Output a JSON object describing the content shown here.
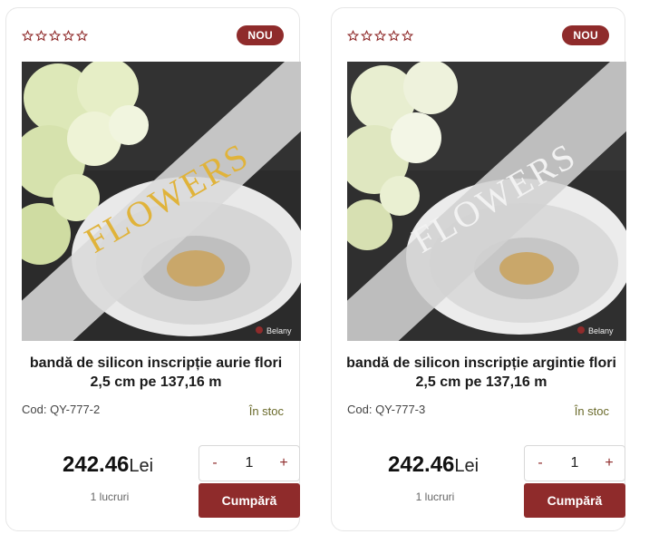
{
  "colors": {
    "accent": "#8f2b2b",
    "stock_text": "#6b6b2c",
    "star_outline": "#8f2b2b"
  },
  "products": [
    {
      "badge": "NOU",
      "rating": 0,
      "image": {
        "ribbon_text": "FLOWERS",
        "text_color": "#e0b33a",
        "watermark": "Belany"
      },
      "title": "bandă de silicon inscripție aurie flori 2,5 cm pe 137,16 m",
      "code": "Cod: QY-777-2",
      "stock": "În stoc",
      "price": "242.46",
      "currency": "Lei",
      "units": "1 lucruri",
      "quantity": "1",
      "qty_minus": "-",
      "qty_plus": "+",
      "buy_label": "Cumpără"
    },
    {
      "badge": "NOU",
      "rating": 0,
      "image": {
        "ribbon_text": "FLOWERS",
        "text_color": "#f2f2f2",
        "watermark": "Belany"
      },
      "title": "bandă de silicon inscripție argintie flori 2,5 cm pe 137,16 m",
      "code": "Cod: QY-777-3",
      "stock": "În stoc",
      "price": "242.46",
      "currency": "Lei",
      "units": "1 lucruri",
      "quantity": "1",
      "qty_minus": "-",
      "qty_plus": "+",
      "buy_label": "Cumpără"
    }
  ]
}
